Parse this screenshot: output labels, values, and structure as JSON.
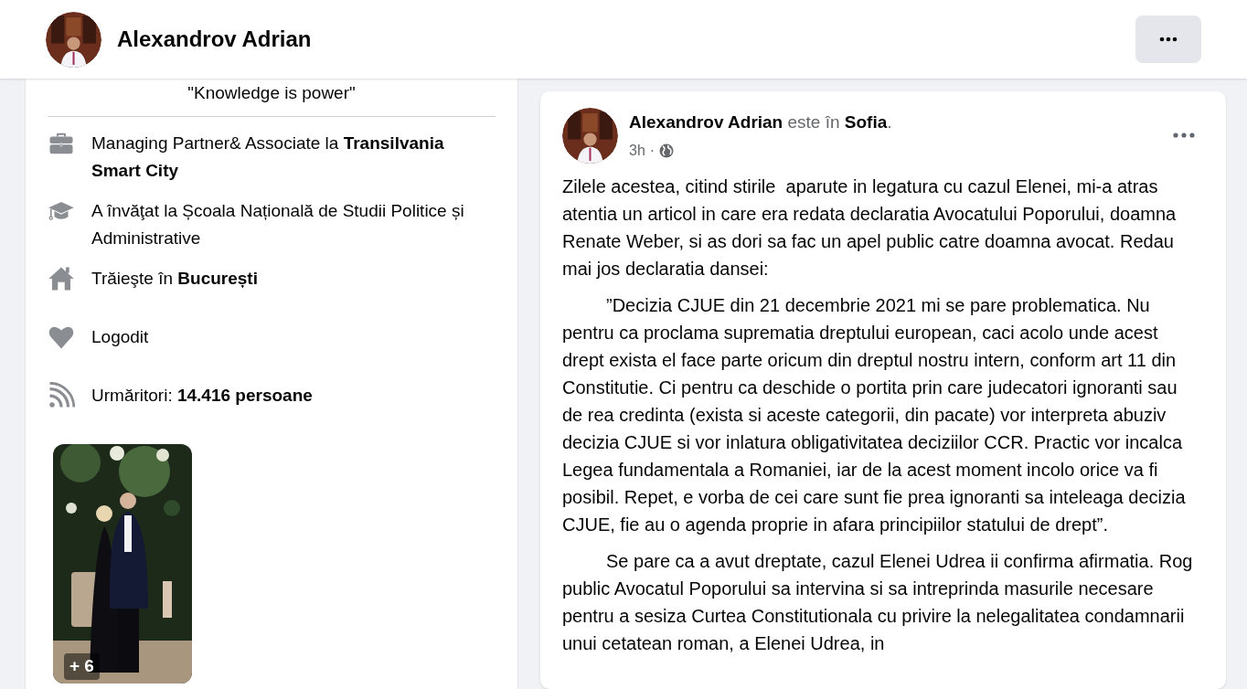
{
  "header": {
    "name": "Alexandrov Adrian"
  },
  "intro": {
    "quote": "\"Knowledge is power\"",
    "details": [
      {
        "kind": "work",
        "text": "Managing Partner& Associate la **Transilvania Smart City**"
      },
      {
        "kind": "education",
        "text": "A învăţat la Școala Națională de Studii Politice și Administrative"
      },
      {
        "kind": "home",
        "text": "Trăieşte în **București**"
      },
      {
        "kind": "relationship",
        "text": "Logodit"
      },
      {
        "kind": "followers",
        "text": "Urmăritori: **14.416 persoane**"
      }
    ],
    "photo": {
      "kind": "picture",
      "badge": "+ 6"
    }
  },
  "post": {
    "heading": "**Alexandrov Adrian** este în **Sofia**.",
    "time": "3h",
    "separator": "·",
    "paragraphs": [
      {
        "indent": false,
        "text": "Zilele acestea, citind stirile  aparute in legatura cu cazul Elenei, mi-a atras atentia un articol in care era redata declaratia Avocatului Poporului, doamna Renate Weber, si as dori sa fac un apel public catre doamna avocat. Redau mai jos declaratia dansei:"
      },
      {
        "indent": true,
        "text": "”Decizia CJUE din 21 decembrie 2021 mi se pare problematica. Nu pentru ca proclama suprematia dreptului european, caci acolo unde acest drept exista el face parte oricum din dreptul nostru intern, conform art 11 din Constitutie. Ci pentru ca deschide o portita prin care judecatori ignoranti sau de rea credinta (exista si aceste categorii, din pacate) vor interpreta abuziv decizia CJUE si vor inlatura obligativitatea deciziilor CCR. Practic vor incalca Legea fundamentala a Romaniei, iar de la acest moment incolo orice va fi posibil. Repet, e vorba de cei care sunt fie prea ignoranti sa inteleaga decizia CJUE, fie au o agenda proprie in afara principiilor statului de drept”."
      },
      {
        "indent": true,
        "text": "Se pare ca a avut dreptate, cazul Elenei Udrea ii confirma afirmatia. Rog public Avocatul Poporului sa intervina si sa intreprinda masurile necesare pentru a sesiza Curtea Constitutionala cu privire la nelegalitatea condamnarii unui cetatean roman, a Elenei Udrea, in"
      }
    ]
  }
}
